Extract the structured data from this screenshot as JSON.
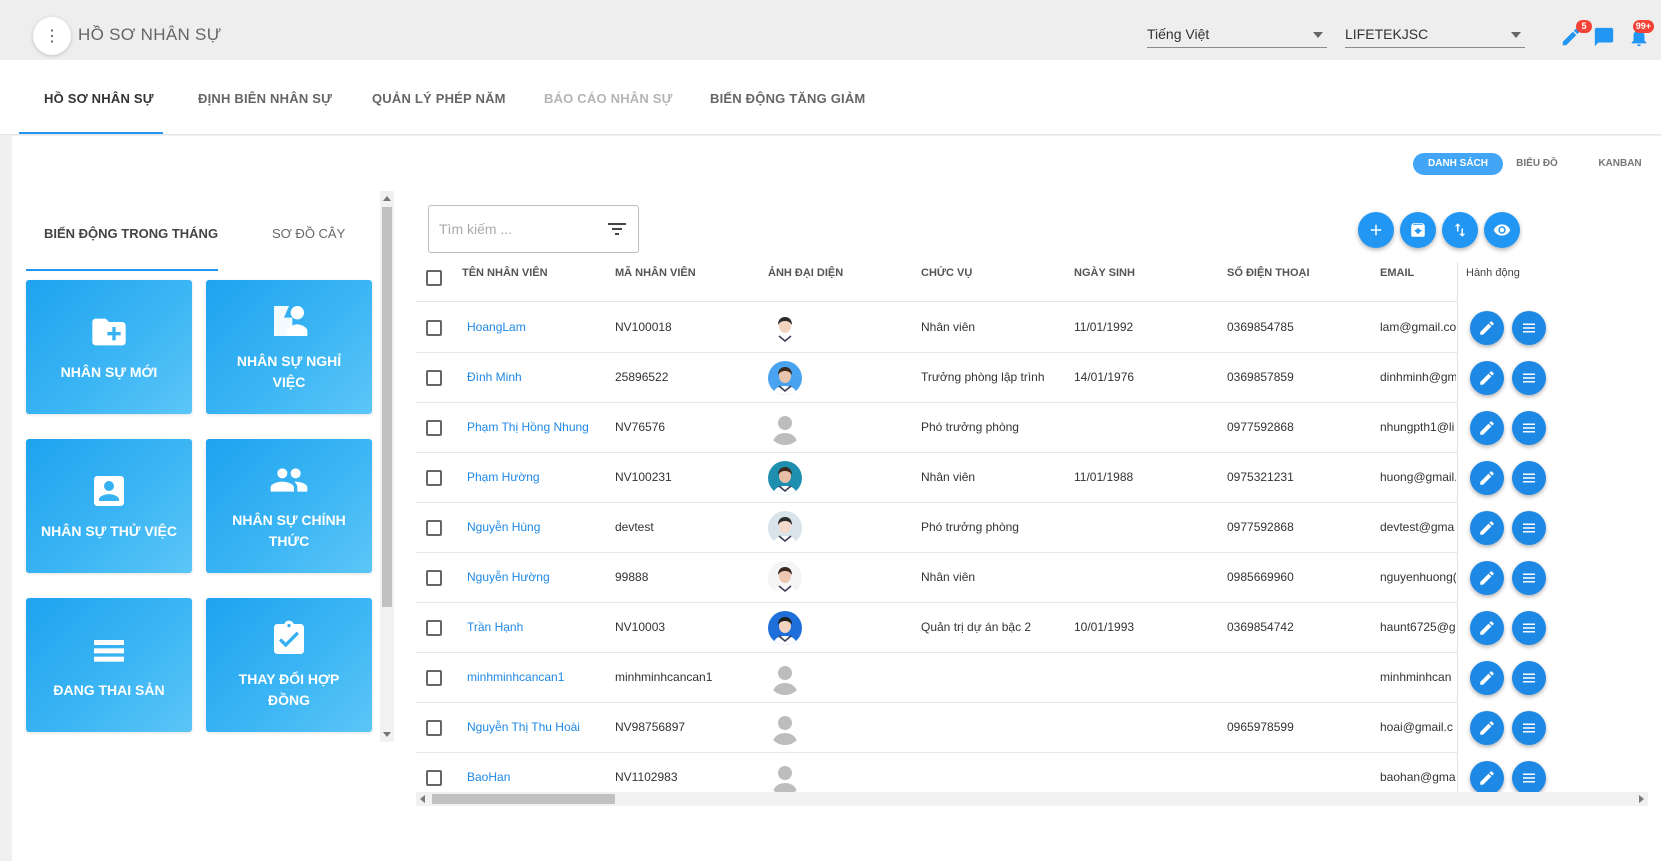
{
  "app": {
    "menu_glyph": "⋮",
    "title": "HỒ SƠ NHÂN SỰ",
    "language": "Tiếng Việt",
    "company": "LIFETEKJSC",
    "notifications": {
      "edit_count": "5",
      "bell_count": "99+"
    }
  },
  "tabs": [
    {
      "label": "HỒ SƠ NHÂN SỰ",
      "state": "active"
    },
    {
      "label": "ĐỊNH BIÊN NHÂN SỰ",
      "state": "normal"
    },
    {
      "label": "QUẢN LÝ PHÉP NĂM",
      "state": "normal"
    },
    {
      "label": "BÁO CÁO NHÂN SỰ",
      "state": "disabled"
    },
    {
      "label": "BIẾN ĐỘNG TĂNG GIẢM",
      "state": "normal"
    }
  ],
  "view_modes": [
    {
      "label": "DANH SÁCH",
      "active": true
    },
    {
      "label": "BIỂU ĐỒ",
      "active": false
    },
    {
      "label": "KANBAN",
      "active": false
    }
  ],
  "left_panel": {
    "tabs": [
      {
        "label": "BIẾN ĐỘNG TRONG THÁNG",
        "active": true
      },
      {
        "label": "SƠ ĐỒ CÂY",
        "active": false
      }
    ],
    "cards": [
      {
        "label": "NHÂN SỰ MỚI",
        "icon": "folder-add-icon"
      },
      {
        "label": "NHÂN SỰ NGHỈ VIỆC",
        "icon": "person-leave-icon"
      },
      {
        "label": "NHÂN SỰ THỬ VIỆC",
        "icon": "id-card-icon"
      },
      {
        "label": "NHÂN SỰ CHÍNH THỨC",
        "icon": "people-icon"
      },
      {
        "label": "ĐANG THAI SẢN",
        "icon": "list-lines-icon"
      },
      {
        "label": "THAY ĐỔI HỢP ĐỒNG",
        "icon": "clipboard-check-icon"
      }
    ]
  },
  "search": {
    "placeholder": "Tìm kiếm ..."
  },
  "toolbar_icons": [
    "add-icon",
    "archive-icon",
    "sort-icon",
    "view-icon"
  ],
  "colors": {
    "accent": "#2196f3",
    "link": "#1e88e5",
    "badge": "#f44336"
  },
  "table": {
    "columns": [
      "TÊN NHÂN VIÊN",
      "MÃ NHÂN VIÊN",
      "ẢNH ĐẠI DIỆN",
      "CHỨC VỤ",
      "NGÀY SINH",
      "SỐ ĐIỆN THOẠI",
      "EMAIL",
      "Hành động"
    ],
    "rows": [
      {
        "name": "HoangLam",
        "code": "NV100018",
        "avatar": "photo",
        "position": "Nhân viên",
        "dob": "11/01/1992",
        "phone": "0369854785",
        "email": "lam@gmail.co"
      },
      {
        "name": "Đình Minh",
        "code": "25896522",
        "avatar": "photo",
        "position": "Trưởng phòng lập trình",
        "dob": "14/01/1976",
        "phone": "0369857859",
        "email": "dinhminh@gm"
      },
      {
        "name": "Phạm Thị Hồng Nhung",
        "code": "NV76576",
        "avatar": "placeholder",
        "position": "Phó trưởng phòng",
        "dob": "",
        "phone": "0977592868",
        "email": "nhungpth1@li"
      },
      {
        "name": "Phạm Hường",
        "code": "NV100231",
        "avatar": "photo",
        "position": "Nhân viên",
        "dob": "11/01/1988",
        "phone": "0975321231",
        "email": "huong@gmail."
      },
      {
        "name": "Nguyễn Hùng",
        "code": "devtest",
        "avatar": "photo",
        "position": "Phó trưởng phòng",
        "dob": "",
        "phone": "0977592868",
        "email": "devtest@gma"
      },
      {
        "name": "Nguyễn Hường",
        "code": "99888",
        "avatar": "photo",
        "position": "Nhân viên",
        "dob": "",
        "phone": "0985669960",
        "email": "nguyenhuong("
      },
      {
        "name": "Trần Hạnh",
        "code": "NV10003",
        "avatar": "photo",
        "position": "Quản trị dự án bậc 2",
        "dob": "10/01/1993",
        "phone": "0369854742",
        "email": "haunt6725@g"
      },
      {
        "name": "minhminhcancan1",
        "code": "minhminhcancan1",
        "avatar": "placeholder",
        "position": "",
        "dob": "",
        "phone": "",
        "email": "minhminhcan"
      },
      {
        "name": "Nguyễn Thị Thu Hoài",
        "code": "NV98756897",
        "avatar": "placeholder",
        "position": "",
        "dob": "",
        "phone": "0965978599",
        "email": "hoai@gmail.c"
      },
      {
        "name": "BaoHan",
        "code": "NV1102983",
        "avatar": "placeholder",
        "position": "",
        "dob": "",
        "phone": "",
        "email": "baohan@gma"
      }
    ]
  }
}
